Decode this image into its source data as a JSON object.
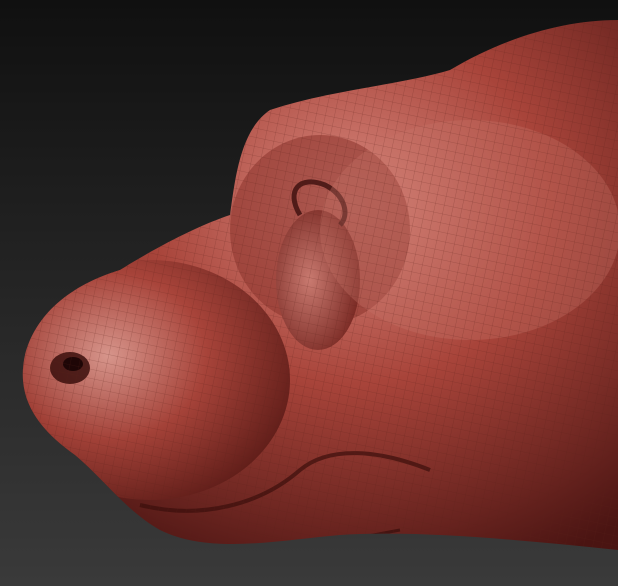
{
  "viewport": {
    "background_top": "#101010",
    "background_bottom": "#3a3a3a",
    "model_color": "#a8443a",
    "model_highlight": "#d98a80",
    "model_shadow": "#4a1412",
    "wire_color": "#5a1e1a"
  }
}
